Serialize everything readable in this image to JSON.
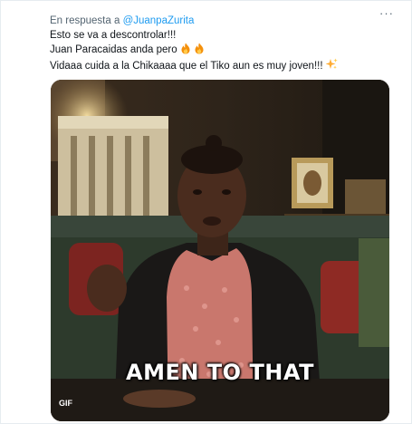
{
  "reply": {
    "prefix": "En respuesta a",
    "handle": "@JuanpaZurita"
  },
  "more_icon": "more-horizontal-icon",
  "tweet": {
    "lines": [
      "Esto se va a descontrolar!!!",
      "Juan Paracaidas anda pero",
      "Vidaaa cuida a la Chikaaaa que el Tiko aun es muy joven!!!"
    ],
    "line2_emoji": [
      "fire-icon",
      "fire-icon"
    ],
    "line3_emoji": "sparkles-icon"
  },
  "media": {
    "caption": "AMEN TO THAT",
    "badge": "GIF"
  },
  "colors": {
    "handle": "#1d9bf0",
    "secondary_text": "#536471",
    "primary_text": "#0f1419"
  }
}
